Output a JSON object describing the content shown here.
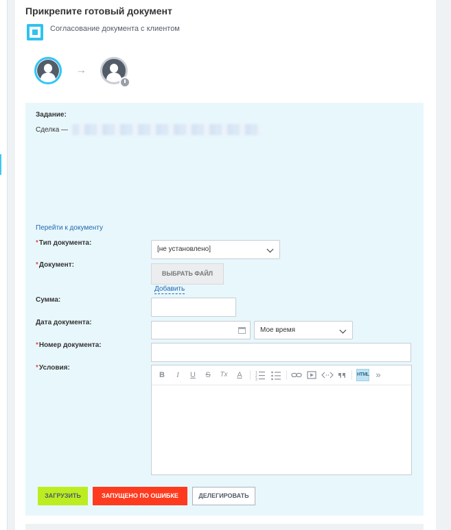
{
  "header": {
    "title": "Прикрепите готовый документ",
    "process_name": "Согласование документа с клиентом"
  },
  "workflow": {
    "arrow": "→"
  },
  "task": {
    "label": "Задание:",
    "deal_prefix": "Сделка —",
    "document_link": "Перейти к документу"
  },
  "form": {
    "required_mark": "*",
    "doc_type_label": "Тип документа:",
    "doc_type_value": "[не установлено]",
    "document_label": "Документ:",
    "choose_file_label": "ВЫБРАТЬ ФАЙЛ",
    "add_label": "Добавить",
    "sum_label": "Сумма:",
    "doc_date_label": "Дата документа:",
    "timezone_value": "Мое время",
    "doc_number_label": "Номер документа:",
    "conditions_label": "Условия:"
  },
  "editor": {
    "toolbar": {
      "bold": "B",
      "italic": "I",
      "underline": "U",
      "strike": "S",
      "remove_format": "Tx",
      "font_color": "A",
      "html": "HTML",
      "more": "»"
    }
  },
  "actions": {
    "upload_label": "ЗАГРУЗИТЬ",
    "error_label": "ЗАПУЩЕНО ПО ОШИБКЕ",
    "delegate_label": "ДЕЛЕГИРОВАТЬ"
  },
  "colors": {
    "accent": "#2fc6f6",
    "task_bg": "#e8f7fc",
    "upload_bg": "#bbed21",
    "error_bg": "#ff3b1f",
    "link": "#2067b0"
  }
}
